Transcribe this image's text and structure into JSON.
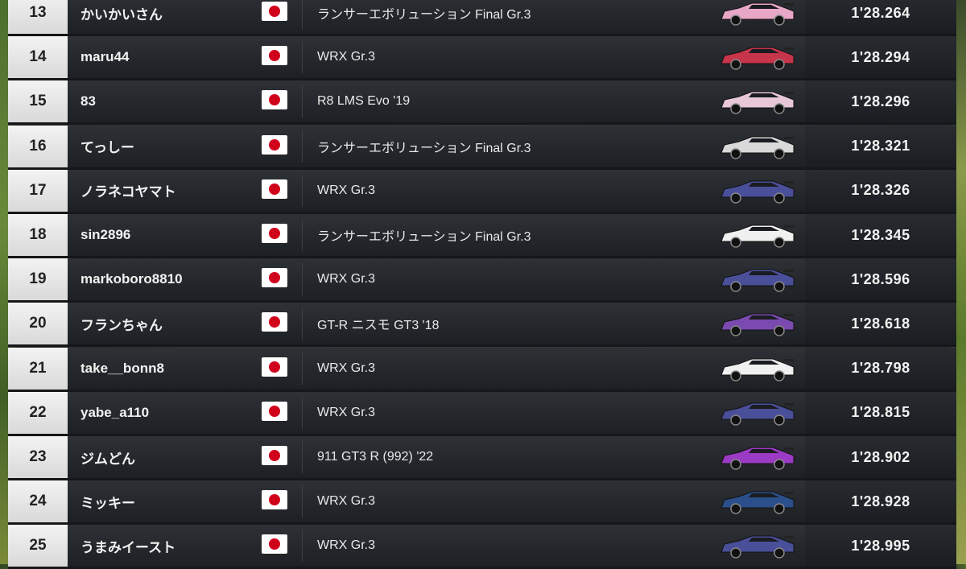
{
  "leaderboard": {
    "rows": [
      {
        "rank": "13",
        "name": "かいかいさん",
        "flag": "japan-flag",
        "car": "ランサーエボリューション Final Gr.3",
        "time": "1'28.264",
        "car_color": "#e9a7c7"
      },
      {
        "rank": "14",
        "name": "maru44",
        "flag": "japan-flag",
        "car": "WRX Gr.3",
        "time": "1'28.294",
        "car_color": "#c7354a"
      },
      {
        "rank": "15",
        "name": "83",
        "flag": "japan-flag",
        "car": "R8 LMS Evo '19",
        "time": "1'28.296",
        "car_color": "#e7c7d8"
      },
      {
        "rank": "16",
        "name": "てっしー",
        "flag": "japan-flag",
        "car": "ランサーエボリューション Final Gr.3",
        "time": "1'28.321",
        "car_color": "#d9d9d9"
      },
      {
        "rank": "17",
        "name": "ノラネコヤマト",
        "flag": "japan-flag",
        "car": "WRX Gr.3",
        "time": "1'28.326",
        "car_color": "#4a4f9a"
      },
      {
        "rank": "18",
        "name": "sin2896",
        "flag": "japan-flag",
        "car": "ランサーエボリューション Final Gr.3",
        "time": "1'28.345",
        "car_color": "#f0f0f0"
      },
      {
        "rank": "19",
        "name": "markoboro8810",
        "flag": "japan-flag",
        "car": "WRX Gr.3",
        "time": "1'28.596",
        "car_color": "#4a4f9a"
      },
      {
        "rank": "20",
        "name": "フランちゃん",
        "flag": "japan-flag",
        "car": "GT-R ニスモ GT3 '18",
        "time": "1'28.618",
        "car_color": "#7a4ab0"
      },
      {
        "rank": "21",
        "name": "take__bonn8",
        "flag": "japan-flag",
        "car": "WRX Gr.3",
        "time": "1'28.798",
        "car_color": "#f0f0f0"
      },
      {
        "rank": "22",
        "name": "yabe_a110",
        "flag": "japan-flag",
        "car": "WRX Gr.3",
        "time": "1'28.815",
        "car_color": "#4a4f9a"
      },
      {
        "rank": "23",
        "name": "ジムどん",
        "flag": "japan-flag",
        "car": "911 GT3 R (992) '22",
        "time": "1'28.902",
        "car_color": "#9b3ac4"
      },
      {
        "rank": "24",
        "name": "ミッキー",
        "flag": "japan-flag",
        "car": "WRX Gr.3",
        "time": "1'28.928",
        "car_color": "#2a4f8a"
      },
      {
        "rank": "25",
        "name": "うまみイースト",
        "flag": "japan-flag",
        "car": "WRX Gr.3",
        "time": "1'28.995",
        "car_color": "#4a4f9a"
      }
    ]
  }
}
